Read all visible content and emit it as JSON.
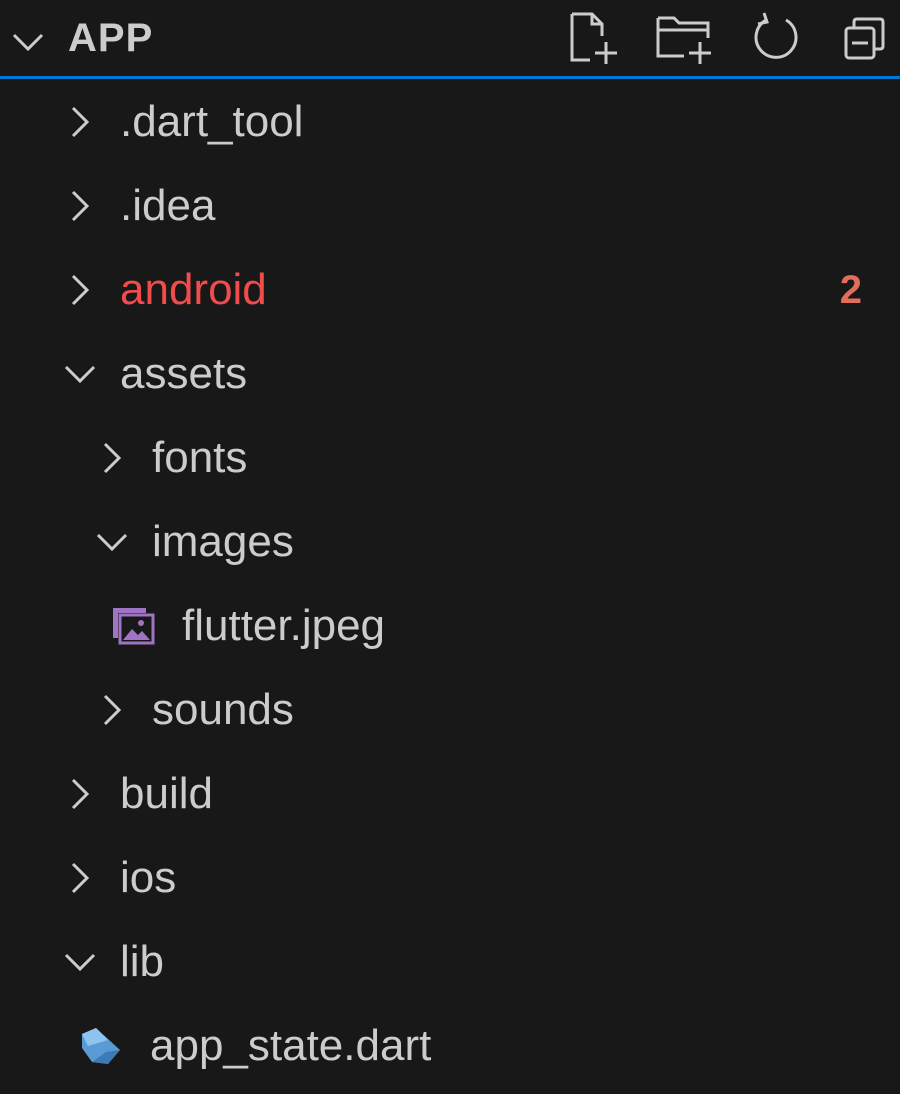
{
  "explorer": {
    "title": "APP",
    "actions": [
      {
        "name": "new-file-button",
        "icon": "new-file-icon"
      },
      {
        "name": "new-folder-button",
        "icon": "new-folder-icon"
      },
      {
        "name": "refresh-button",
        "icon": "refresh-icon"
      },
      {
        "name": "collapse-all-button",
        "icon": "collapse-all-icon"
      }
    ]
  },
  "tree": {
    "items": [
      {
        "label": ".dart_tool",
        "type": "folder",
        "expanded": false,
        "depth": 1
      },
      {
        "label": ".idea",
        "type": "folder",
        "expanded": false,
        "depth": 1
      },
      {
        "label": "android",
        "type": "folder",
        "expanded": false,
        "depth": 1,
        "badge": "2",
        "status_color": "#f14c4c"
      },
      {
        "label": "assets",
        "type": "folder",
        "expanded": true,
        "depth": 1
      },
      {
        "label": "fonts",
        "type": "folder",
        "expanded": false,
        "depth": 2
      },
      {
        "label": "images",
        "type": "folder",
        "expanded": true,
        "depth": 2
      },
      {
        "label": "flutter.jpeg",
        "type": "file",
        "icon": "image-file-icon",
        "depth": 3
      },
      {
        "label": "sounds",
        "type": "folder",
        "expanded": false,
        "depth": 2
      },
      {
        "label": "build",
        "type": "folder",
        "expanded": false,
        "depth": 1
      },
      {
        "label": "ios",
        "type": "folder",
        "expanded": false,
        "depth": 1
      },
      {
        "label": "lib",
        "type": "folder",
        "expanded": true,
        "depth": 1
      },
      {
        "label": "app_state.dart",
        "type": "file",
        "icon": "dart-file-icon",
        "depth": 2
      }
    ]
  },
  "colors": {
    "background": "#181818",
    "text": "#cccccc",
    "focus_border": "#0078d4",
    "error": "#f14c4c",
    "badge": "#e16d5b",
    "image_icon": "#a074c4",
    "dart_icon": "#5b9bd5"
  }
}
